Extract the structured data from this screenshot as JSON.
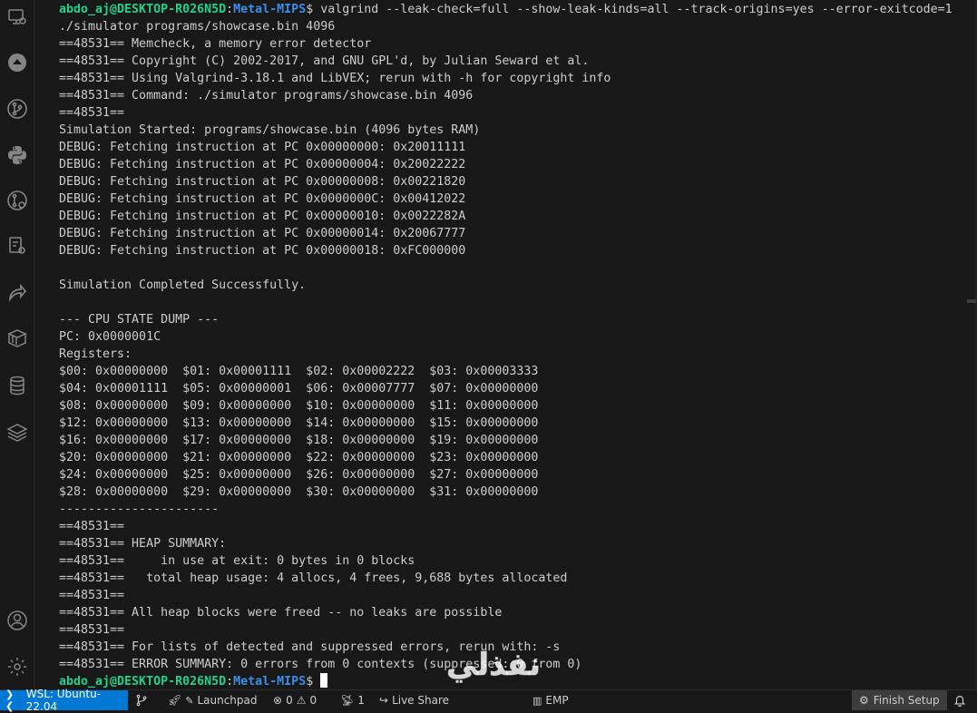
{
  "terminal": {
    "prompt_user": "abdo_aj@DESKTOP-R026N5D",
    "prompt_path": "Metal-MIPS",
    "prompt_suffix": "$ ",
    "command": "valgrind --leak-check=full --show-leak-kinds=all --track-origins=yes --error-exitcode=1",
    "lines": [
      "./simulator programs/showcase.bin 4096",
      "==48531== Memcheck, a memory error detector",
      "==48531== Copyright (C) 2002-2017, and GNU GPL'd, by Julian Seward et al.",
      "==48531== Using Valgrind-3.18.1 and LibVEX; rerun with -h for copyright info",
      "==48531== Command: ./simulator programs/showcase.bin 4096",
      "==48531==",
      "Simulation Started: programs/showcase.bin (4096 bytes RAM)",
      "DEBUG: Fetching instruction at PC 0x00000000: 0x20011111",
      "DEBUG: Fetching instruction at PC 0x00000004: 0x20022222",
      "DEBUG: Fetching instruction at PC 0x00000008: 0x00221820",
      "DEBUG: Fetching instruction at PC 0x0000000C: 0x00412022",
      "DEBUG: Fetching instruction at PC 0x00000010: 0x0022282A",
      "DEBUG: Fetching instruction at PC 0x00000014: 0x20067777",
      "DEBUG: Fetching instruction at PC 0x00000018: 0xFC000000",
      "",
      "Simulation Completed Successfully.",
      "",
      "--- CPU STATE DUMP ---",
      "PC: 0x0000001C",
      "Registers:",
      "$00: 0x00000000  $01: 0x00001111  $02: 0x00002222  $03: 0x00003333",
      "$04: 0x00001111  $05: 0x00000001  $06: 0x00007777  $07: 0x00000000",
      "$08: 0x00000000  $09: 0x00000000  $10: 0x00000000  $11: 0x00000000",
      "$12: 0x00000000  $13: 0x00000000  $14: 0x00000000  $15: 0x00000000",
      "$16: 0x00000000  $17: 0x00000000  $18: 0x00000000  $19: 0x00000000",
      "$20: 0x00000000  $21: 0x00000000  $22: 0x00000000  $23: 0x00000000",
      "$24: 0x00000000  $25: 0x00000000  $26: 0x00000000  $27: 0x00000000",
      "$28: 0x00000000  $29: 0x00000000  $30: 0x00000000  $31: 0x00000000",
      "----------------------",
      "==48531==",
      "==48531== HEAP SUMMARY:",
      "==48531==     in use at exit: 0 bytes in 0 blocks",
      "==48531==   total heap usage: 4 allocs, 4 frees, 9,688 bytes allocated",
      "==48531==",
      "==48531== All heap blocks were freed -- no leaks are possible",
      "==48531==",
      "==48531== For lists of detected and suppressed errors, rerun with: -s",
      "==48531== ERROR SUMMARY: 0 errors from 0 contexts (suppressed: 0 from 0)"
    ]
  },
  "activity_bar": {
    "icons": [
      "remote-explorer-icon",
      "testing-icon",
      "source-control-icon",
      "python-icon",
      "docker-icon",
      "extensions-remote-icon",
      "live-share-icon",
      "containers-icon",
      "database-icon",
      "layers-icon",
      "account-icon",
      "settings-gear-icon"
    ]
  },
  "statusbar": {
    "remote": "WSL: Ubuntu-22.04",
    "launchpad": "Launchpad",
    "errors": "0",
    "warnings": "0",
    "ports": "1",
    "live_share": "Live Share",
    "emp": "EMP",
    "finish_setup": "Finish Setup"
  },
  "colors": {
    "background": "#181818",
    "text": "#cccccc",
    "prompt_user": "#23d18b",
    "prompt_path": "#3b8eea",
    "remote_badge": "#0078d4"
  },
  "watermark": {
    "text": "نفذلي",
    "subtext": "nafezly.com"
  }
}
